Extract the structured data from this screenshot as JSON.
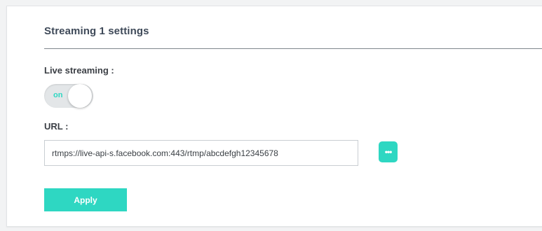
{
  "settings": {
    "title": "Streaming 1 settings",
    "live_streaming_label": "Live streaming :",
    "toggle": {
      "state_label": "on",
      "enabled": true
    },
    "url_label": "URL :",
    "url_value": "rtmps://live-api-s.facebook.com:443/rtmp/abcdefgh12345678",
    "more_button_label": "•••",
    "apply_label": "Apply"
  },
  "colors": {
    "accent": "#2ed7c2",
    "title_text": "#3f4a59",
    "label_text": "#3b3f45",
    "divider": "#7f868c"
  },
  "icons": {
    "more": "ellipsis-icon"
  }
}
